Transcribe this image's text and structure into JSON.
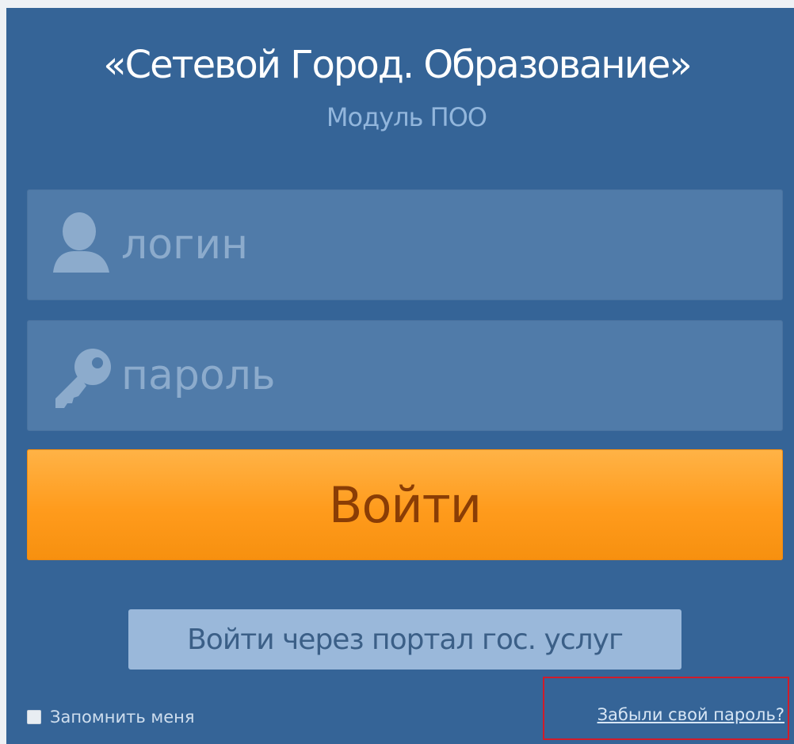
{
  "header": {
    "title": "«Сетевой Город. Образование»",
    "subtitle": "Модуль ПОО"
  },
  "login_form": {
    "login": {
      "icon": "user-icon",
      "placeholder": "логин",
      "value": ""
    },
    "password": {
      "icon": "key-icon",
      "placeholder": "пароль",
      "value": ""
    },
    "submit_label": "Войти",
    "gosuslugi_label": "Войти через портал гос. услуг",
    "remember_label": "Запомнить меня",
    "remember_checked": false,
    "forgot_label": "Забыли свой пароль?"
  },
  "colors": {
    "panel": "#356497",
    "field": "#507ba9",
    "accent": "#ff9b1c",
    "highlight": "#d11c2a"
  }
}
